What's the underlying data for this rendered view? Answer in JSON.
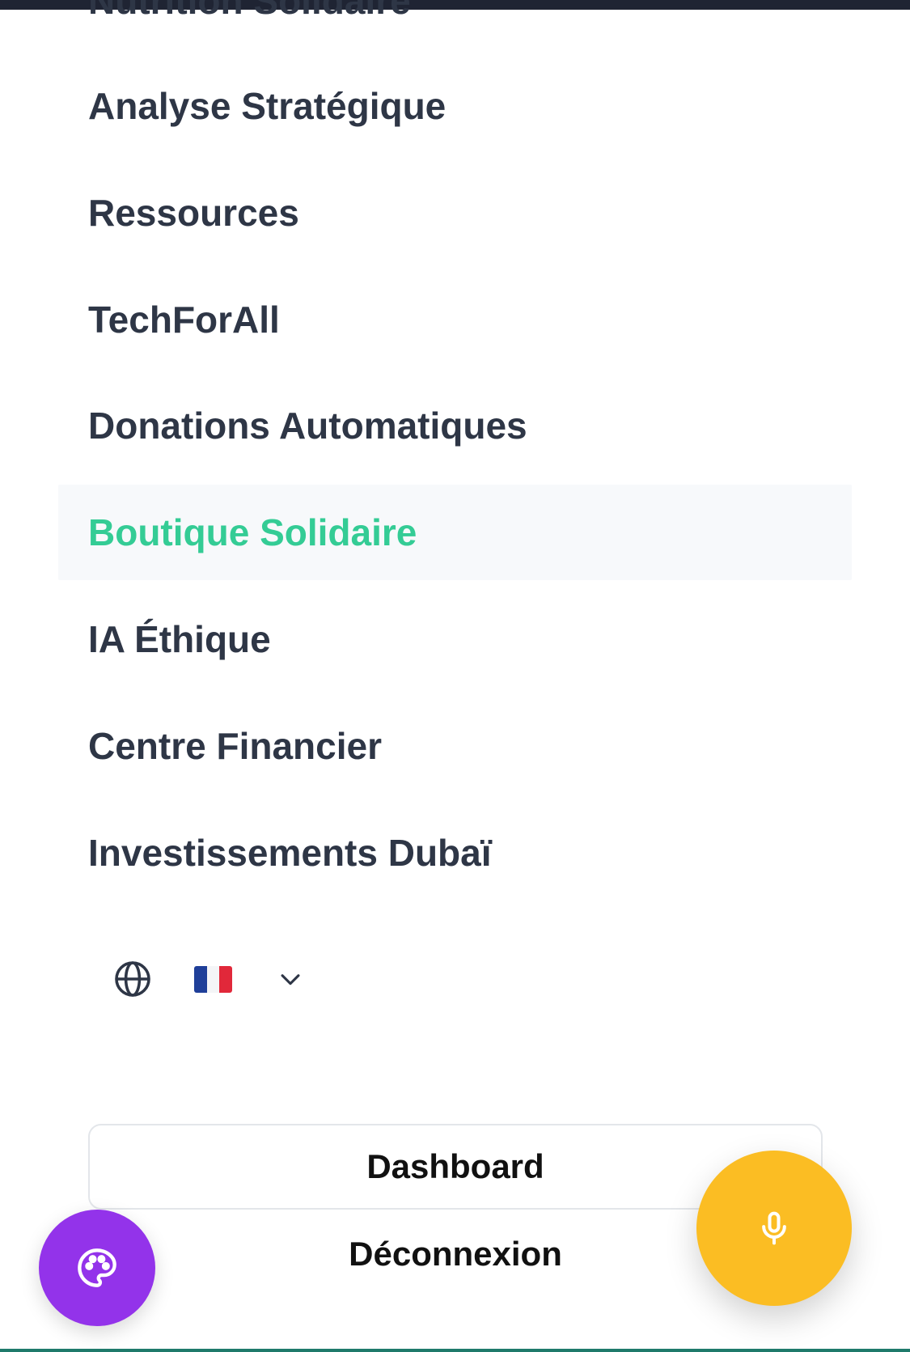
{
  "menu": {
    "clipped_item": "Nutrition Solidaire",
    "items": [
      {
        "label": "Analyse Stratégique",
        "active": false
      },
      {
        "label": "Ressources",
        "active": false
      },
      {
        "label": "TechForAll",
        "active": false
      },
      {
        "label": "Donations Automatiques",
        "active": false
      },
      {
        "label": "Boutique Solidaire",
        "active": true
      },
      {
        "label": "IA Éthique",
        "active": false
      },
      {
        "label": "Centre Financier",
        "active": false
      },
      {
        "label": "Investissements Dubaï",
        "active": false
      }
    ]
  },
  "language": {
    "icon": "globe-icon",
    "selected_flag": "FR",
    "dropdown_icon": "chevron-down-icon"
  },
  "actions": {
    "dashboard_label": "Dashboard",
    "logout_label": "Déconnexion"
  },
  "fabs": {
    "theme_icon": "palette-icon",
    "mic_icon": "microphone-icon"
  },
  "colors": {
    "text": "#2e3646",
    "active_text": "#34cc95",
    "active_bg": "#f7f9fb",
    "theme_fab": "#9333ea",
    "mic_fab": "#fbbd23"
  }
}
